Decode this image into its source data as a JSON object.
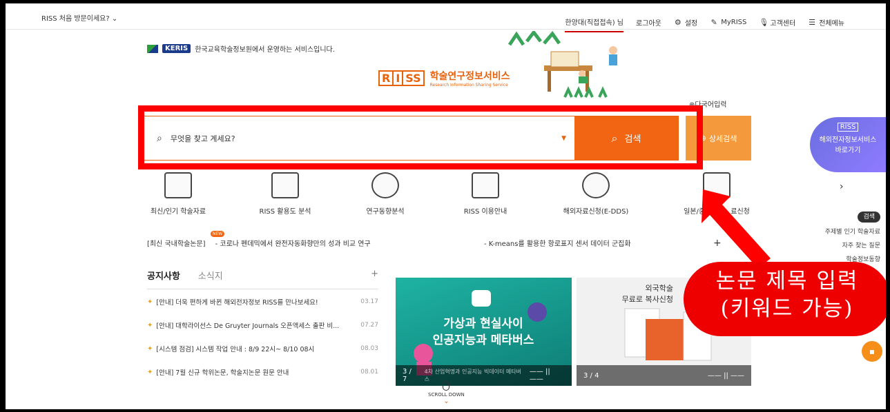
{
  "topbar": {
    "first_visit": "RISS 처음 방문이세요?",
    "user": "한양대(직접접속) 님",
    "logout": "로그아웃",
    "settings": "설정",
    "myriss": "MyRISS",
    "support": "고객센터",
    "all_menu": "전체메뉴"
  },
  "header": {
    "keris_logo": "KERIS",
    "keris_text": "한국교육학술정보원에서 운영하는 서비스입니다.",
    "riss_letters": [
      "R",
      "I",
      "SS"
    ],
    "riss_title": "학술연구정보서비스",
    "riss_subtitle": "Research Information Sharing Service",
    "multilang": "다국어입력"
  },
  "search": {
    "placeholder": "무엇을 찾고 계세요?",
    "search_button": "검색",
    "advanced_button": "상세검색"
  },
  "overseas": {
    "logo": "RISS",
    "line1": "해외전자정보서비스",
    "line2": "바로가기"
  },
  "menus": [
    {
      "label": "최신/인기 학술자료"
    },
    {
      "label": "RISS 활용도 분석"
    },
    {
      "label": "연구동향분석"
    },
    {
      "label": "RISS 이용안내"
    },
    {
      "label": "해외자료신청(E-DDS)"
    },
    {
      "label": "일본/중국"
    },
    {
      "label": "료신청"
    }
  ],
  "quick": {
    "tag": "검색",
    "items": [
      "주제별 인기 학술자료",
      "자주 찾는 질문",
      "학술정보동향"
    ]
  },
  "latest": {
    "label": "[최신 국내학술논문]",
    "new_badge": "NEW",
    "paper1": "- 코로나 펜데믹에서 완전자동화향만의 성과 비교 연구",
    "paper2": "- K-means를 활용한 항로표지 센서 데이터 군집화",
    "plus": "+"
  },
  "notice": {
    "tab_notice": "공지사항",
    "tab_news": "소식지",
    "plus": "+",
    "rows": [
      {
        "title": "[안내] 더욱 편하게 바뀐 해외전자정보 RISS를 만나보세요!",
        "date": "03.17"
      },
      {
        "title": "[안내] 대학라이선스 De Gruyter Journals 오픈액세스 출판 비...",
        "date": "07.27"
      },
      {
        "title": "[시스템 점검] 시스템 작업 안내 : 8/9 22시~ 8/10 08시",
        "date": "08.03"
      },
      {
        "title": "[안내] 7월 신규 학위논문, 학술지논문 원문 안내",
        "date": "08.01"
      }
    ]
  },
  "banner1": {
    "line1": "가상과 현실사이",
    "line2": "인공지능과 메타버스",
    "counter": "3 / 7",
    "caption": "4차 산업혁명과 인공지능 빅데이터 메타버스",
    "controls": "—— ||  ——"
  },
  "banner2": {
    "line1": "외국학술",
    "line2": "무료로 복사신청",
    "counter": "3 / 4",
    "controls": "—— ||  ——"
  },
  "scroll": {
    "label": "SCROLL DOWN"
  },
  "annotation": {
    "line1": "논문 제목 입력",
    "line2": "(키워드 가능)"
  }
}
